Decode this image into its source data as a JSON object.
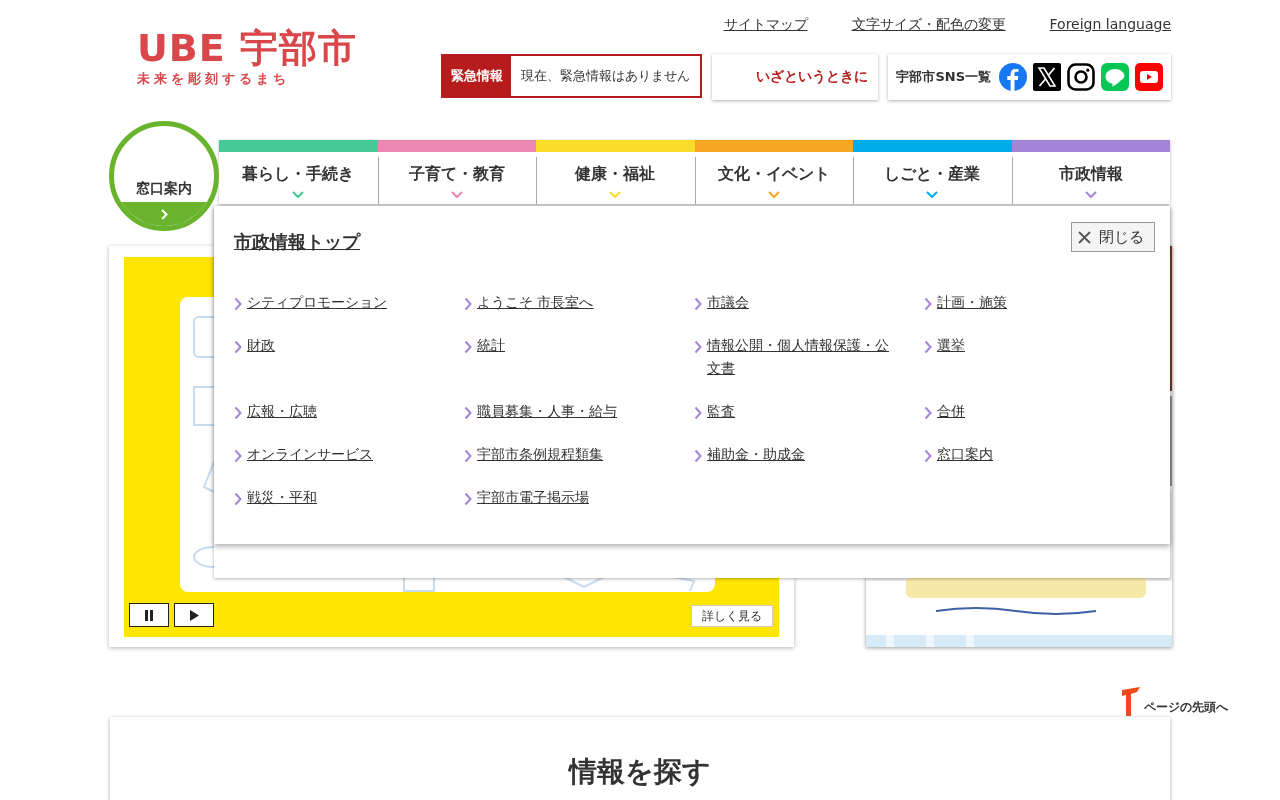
{
  "logo": {
    "mark": "UBE 宇部市",
    "tagline": "未来を彫刻するまち"
  },
  "utility_links": [
    "サイトマップ",
    "文字サイズ・配色の変更",
    "Foreign language"
  ],
  "emergency": {
    "label": "緊急情報",
    "message": "現在、緊急情報はありません"
  },
  "disaster_link": "いざというときに",
  "sns": {
    "label": "宇部市SNS一覧",
    "services": [
      {
        "kind": "facebook"
      },
      {
        "kind": "x"
      },
      {
        "kind": "instagram"
      },
      {
        "kind": "line"
      },
      {
        "kind": "youtube"
      }
    ]
  },
  "counter_button": "窓口案内",
  "nav": [
    {
      "label": "暮らし・手続き",
      "color": "#45c995"
    },
    {
      "label": "子育て・教育",
      "color": "#ec87b4"
    },
    {
      "label": "健康・福祉",
      "color": "#fadc2a"
    },
    {
      "label": "文化・イベント",
      "color": "#f5a623"
    },
    {
      "label": "しごと・産業",
      "color": "#00ade8"
    },
    {
      "label": "市政情報",
      "color": "#a585d8"
    }
  ],
  "dropdown": {
    "title": "市政情報トップ",
    "close": "閉じる",
    "links": [
      "シティプロモーション",
      "ようこそ 市長室へ",
      "市議会",
      "計画・施策",
      "財政",
      "統計",
      "情報公開・個人情報保護・公文書",
      "選挙",
      "広報・広聴",
      "職員募集・人事・給与",
      "監査",
      "合併",
      "オンラインサービス",
      "宇部市条例規程類集",
      "補助金・助成金",
      "窓口案内",
      "戦災・平和",
      "宇部市電子掲示場"
    ]
  },
  "slideshow": {
    "controls": [
      {
        "kind": "pause"
      },
      {
        "kind": "play"
      }
    ],
    "more": "詳しく見る"
  },
  "back_to_top": "ページの先頭へ",
  "search_section": {
    "title": "情報を探す"
  }
}
